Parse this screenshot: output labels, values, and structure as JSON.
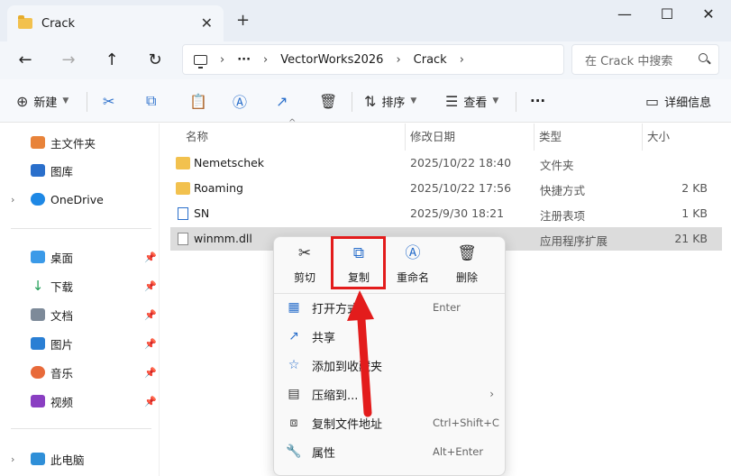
{
  "window": {
    "tab_title": "Crack",
    "tab_close": "✕",
    "tab_add": "+",
    "minimize": "—",
    "maximize": "☐",
    "close": "✕"
  },
  "nav": {
    "back": "←",
    "forward": "→",
    "up": "↑",
    "refresh": "↻"
  },
  "address": {
    "more": "···",
    "crumbs": [
      "VectorWorks2026",
      "Crack"
    ],
    "sep": "›"
  },
  "search": {
    "placeholder": "在 Crack 中搜索"
  },
  "toolbar": {
    "new_label": "新建",
    "sort_label": "排序",
    "view_label": "查看",
    "more": "···",
    "details_label": "详细信息"
  },
  "sidebar": {
    "home": "主文件夹",
    "gallery": "图库",
    "onedrive": "OneDrive",
    "quick": [
      {
        "label": "桌面"
      },
      {
        "label": "下载"
      },
      {
        "label": "文档"
      },
      {
        "label": "图片"
      },
      {
        "label": "音乐"
      },
      {
        "label": "视频"
      }
    ],
    "thispc": "此电脑"
  },
  "columns": {
    "name": "名称",
    "date": "修改日期",
    "type": "类型",
    "size": "大小"
  },
  "files": [
    {
      "name": "Nemetschek",
      "date": "2025/10/22 18:40",
      "type": "文件夹",
      "size": ""
    },
    {
      "name": "Roaming",
      "date": "2025/10/22 17:56",
      "type": "快捷方式",
      "size": "2 KB"
    },
    {
      "name": "SN",
      "date": "2025/9/30 18:21",
      "type": "注册表项",
      "size": "1 KB"
    },
    {
      "name": "winmm.dll",
      "date": "",
      "type": "应用程序扩展",
      "size": "21 KB"
    }
  ],
  "context_menu": {
    "quick": [
      {
        "label": "剪切",
        "icon": "scissors-icon"
      },
      {
        "label": "复制",
        "icon": "copy-icon"
      },
      {
        "label": "重命名",
        "icon": "rename-icon"
      },
      {
        "label": "删除",
        "icon": "trash-icon"
      }
    ],
    "items": [
      {
        "label": "打开方式",
        "shortcut": "Enter"
      },
      {
        "label": "共享",
        "shortcut": ""
      },
      {
        "label": "添加到收藏夹",
        "shortcut": ""
      },
      {
        "label": "压缩到...",
        "shortcut": ""
      },
      {
        "label": "复制文件地址",
        "shortcut": "Ctrl+Shift+C"
      },
      {
        "label": "属性",
        "shortcut": "Alt+Enter"
      }
    ]
  },
  "colors": {
    "accent": "#2a6fcb",
    "highlight": "#e31c1c",
    "selection": "#dcdcdc"
  }
}
